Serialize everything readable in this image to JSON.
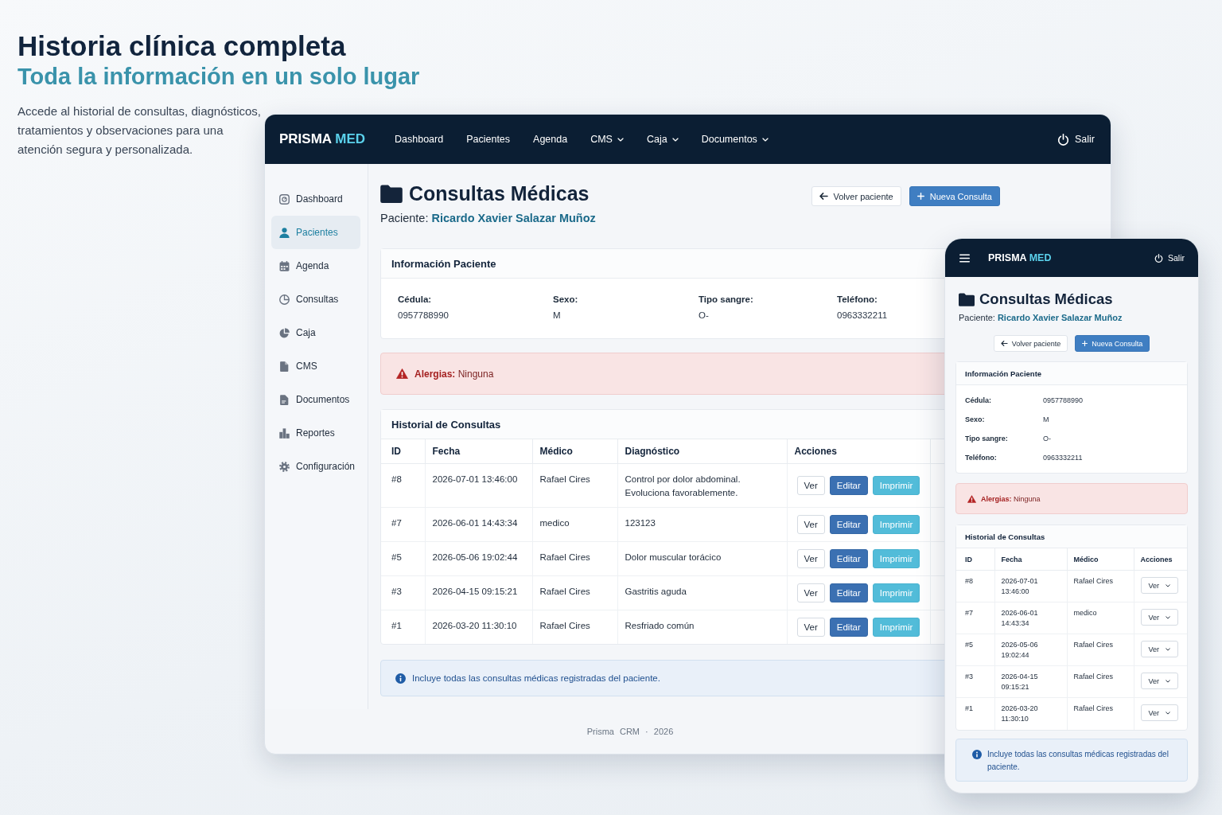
{
  "hero": {
    "title": "Historia clínica completa",
    "subtitle": "Toda la información en un solo lugar",
    "description": "Accede al historial de consultas, diagnósticos, tratamientos y observaciones para una atención segura y personalizada."
  },
  "desktop": {
    "navbar": {
      "brand": "PRISMA",
      "brand_accent": "MED",
      "items": [
        {
          "label": "Dashboard",
          "dropdown": false
        },
        {
          "label": "Pacientes",
          "dropdown": false
        },
        {
          "label": "Agenda",
          "dropdown": false
        },
        {
          "label": "CMS",
          "dropdown": true
        },
        {
          "label": "Caja",
          "dropdown": true
        },
        {
          "label": "Documentos",
          "dropdown": true
        }
      ],
      "logout": "Salir"
    },
    "sidebar": {
      "items": [
        {
          "label": "Dashboard",
          "selected": false
        },
        {
          "label": "Pacientes",
          "selected": true
        },
        {
          "label": "Agenda",
          "selected": false
        },
        {
          "label": "Consultas",
          "selected": false
        },
        {
          "label": "Caja",
          "selected": false
        },
        {
          "label": "CMS",
          "selected": false
        },
        {
          "label": "Documentos",
          "selected": false
        },
        {
          "label": "Reportes",
          "selected": false
        },
        {
          "label": "Configuración",
          "selected": false
        }
      ]
    },
    "header": {
      "title": "Consultas Médicas",
      "patient": "Paciente: **Ricardo Xavier Salazar Muñoz**",
      "buttons": [
        {
          "label": "Volver paciente",
          "kind": "back"
        },
        {
          "label": "Nueva Consulta",
          "kind": "add"
        }
      ]
    },
    "patient_card": {
      "title": "Información Paciente",
      "fields": [
        {
          "label": "Cédula:",
          "value": "0957788990"
        },
        {
          "label": "Sexo:",
          "value": "M"
        },
        {
          "label": "Tipo sangre:",
          "value": "O-"
        },
        {
          "label": "Teléfono:",
          "value": "0963332211"
        }
      ]
    },
    "allergy_alert": "**Alergias:** Ninguna",
    "history": {
      "title": "Historial de Consultas",
      "columns": [
        "ID",
        "Fecha",
        "Médico",
        "Diagnóstico",
        "Acciones"
      ],
      "rows": [
        {
          "id": "#8",
          "date": "2026-07-01 13:46:00",
          "doctor": "Rafael Cires",
          "diagnosis": "Control por dolor abdominal. Evoluciona favorablemente.",
          "actions": [
            {
              "label": "Ver",
              "kind": "view"
            },
            {
              "label": "Editar",
              "kind": "edit"
            },
            {
              "label": "Imprimir",
              "kind": "print"
            }
          ]
        },
        {
          "id": "#7",
          "date": "2026-06-01 14:43:34",
          "doctor": "medico",
          "diagnosis": "123123",
          "actions": [
            {
              "label": "Ver",
              "kind": "view"
            },
            {
              "label": "Editar",
              "kind": "edit"
            },
            {
              "label": "Imprimir",
              "kind": "print"
            }
          ]
        },
        {
          "id": "#5",
          "date": "2026-05-06 19:02:44",
          "doctor": "Rafael Cires",
          "diagnosis": "Dolor muscular torácico",
          "actions": [
            {
              "label": "Ver",
              "kind": "view"
            },
            {
              "label": "Editar",
              "kind": "edit"
            },
            {
              "label": "Imprimir",
              "kind": "print"
            }
          ]
        },
        {
          "id": "#3",
          "date": "2026-04-15 09:15:21",
          "doctor": "Rafael Cires",
          "diagnosis": "Gastritis aguda",
          "actions": [
            {
              "label": "Ver",
              "kind": "view"
            },
            {
              "label": "Editar",
              "kind": "edit"
            },
            {
              "label": "Imprimir",
              "kind": "print"
            }
          ]
        },
        {
          "id": "#1",
          "date": "2026-03-20 11:30:10",
          "doctor": "Rafael Cires",
          "diagnosis": "Resfriado común",
          "actions": [
            {
              "label": "Ver",
              "kind": "view"
            },
            {
              "label": "Editar",
              "kind": "edit"
            },
            {
              "label": "Imprimir",
              "kind": "print"
            }
          ]
        }
      ]
    },
    "info_note": "Incluye todas las consultas médicas registradas del paciente.",
    "footer": "Prisma CRM · 2026"
  },
  "mobile": {
    "navbar": {
      "brand": "PRISMA",
      "brand_accent": "MED",
      "logout": "Salir"
    },
    "header": {
      "title": "Consultas Médicas",
      "patient": "Paciente: **Ricardo Xavier Salazar Muñoz**",
      "buttons": [
        {
          "label": "Volver paciente",
          "kind": "back"
        },
        {
          "label": "Nueva Consulta",
          "kind": "add"
        }
      ]
    },
    "patient_card": {
      "title": "Información Paciente",
      "fields": [
        {
          "label": "Cédula:",
          "value": "0957788990"
        },
        {
          "label": "Sexo:",
          "value": "M"
        },
        {
          "label": "Tipo sangre:",
          "value": "O-"
        },
        {
          "label": "Teléfono:",
          "value": "0963332211"
        }
      ]
    },
    "allergy_alert": "**Alergias:** Ninguna",
    "history": {
      "title": "Historial de Consultas",
      "columns": [
        "ID",
        "Fecha",
        "Médico",
        "Acciones"
      ],
      "rows": [
        {
          "id": "#8",
          "date": "2026-07-01 13:46:00",
          "doctor": "Rafael Cires",
          "action": {
            "label": "Ver",
            "kind": "dropdown"
          }
        },
        {
          "id": "#7",
          "date": "2026-06-01 14:43:34",
          "doctor": "medico",
          "action": {
            "label": "Ver",
            "kind": "dropdown"
          }
        },
        {
          "id": "#5",
          "date": "2026-05-06 19:02:44",
          "doctor": "Rafael Cires",
          "action": {
            "label": "Ver",
            "kind": "dropdown"
          }
        },
        {
          "id": "#3",
          "date": "2026-04-15 09:15:21",
          "doctor": "Rafael Cires",
          "action": {
            "label": "Ver",
            "kind": "dropdown"
          }
        },
        {
          "id": "#1",
          "date": "2026-03-20 11:30:10",
          "doctor": "Rafael Cires",
          "action": {
            "label": "Ver",
            "kind": "dropdown"
          }
        }
      ]
    },
    "info_note": "Incluye todas las consultas médicas registradas del paciente."
  }
}
